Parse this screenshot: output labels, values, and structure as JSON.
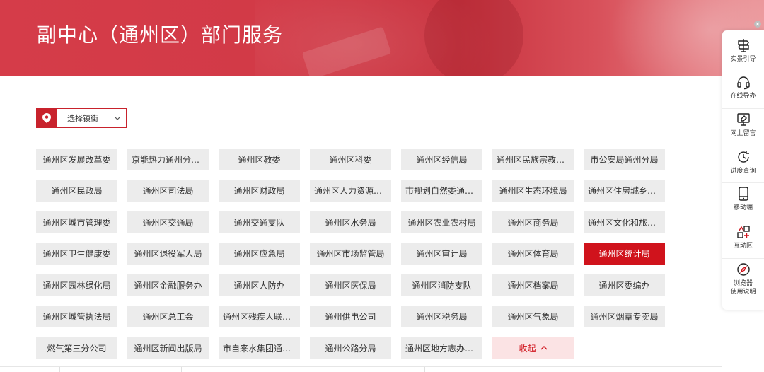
{
  "page": {
    "title": "副中心（通州区）部门服务"
  },
  "street_select": {
    "label": "选择镇街"
  },
  "departments": [
    [
      "通州区发展改革委",
      "京能热力通州分公司",
      "通州区教委",
      "通州区科委",
      "通州区经信局",
      "通州区民族宗教侨…",
      "市公安局通州分局"
    ],
    [
      "通州区民政局",
      "通州区司法局",
      "通州区财政局",
      "通州区人力资源社…",
      "市规划自然委通州…",
      "通州区生态环境局",
      "通州区住房城乡建…"
    ],
    [
      "通州区城市管理委",
      "通州区交通局",
      "通州交通支队",
      "通州区水务局",
      "通州区农业农村局",
      "通州区商务局",
      "通州区文化和旅游局"
    ],
    [
      "通州区卫生健康委",
      "通州区退役军人局",
      "通州区应急局",
      "通州区市场监管局",
      "通州区审计局",
      "通州区体育局",
      "通州区统计局"
    ],
    [
      "通州区园林绿化局",
      "通州区金融服务办",
      "通州区人防办",
      "通州区医保局",
      "通州区消防支队",
      "通州区档案局",
      "通州区委编办"
    ],
    [
      "通州区城管执法局",
      "通州区总工会",
      "通州区残疾人联合会",
      "通州供电公司",
      "通州区税务局",
      "通州区气象局",
      "通州区烟草专卖局"
    ],
    [
      "燃气第三分公司",
      "通州区新闻出版局",
      "市自来水集团通州…",
      "通州公路分局",
      "通州区地方志办公室"
    ]
  ],
  "active_department": "通州区统计局",
  "collapse_label": "收起",
  "toolbar": {
    "items": [
      {
        "label": "实景引导",
        "icon": "signpost-icon"
      },
      {
        "label": "在线导办",
        "icon": "headset-icon"
      },
      {
        "label": "网上留言",
        "icon": "message-icon"
      },
      {
        "label": "进度查询",
        "icon": "progress-icon"
      },
      {
        "label": "移动端",
        "icon": "mobile-icon"
      },
      {
        "label": "互动区",
        "icon": "interaction-icon"
      },
      {
        "label": "浏览器使用说明",
        "icon": "compass-icon",
        "lines": [
          "浏览器",
          "使用说明"
        ]
      }
    ]
  },
  "colors": {
    "brand_red": "#d0131c",
    "banner_red": "#d23a47",
    "tag_gray": "#ececec",
    "collapse_bg": "#fbe3e4"
  }
}
